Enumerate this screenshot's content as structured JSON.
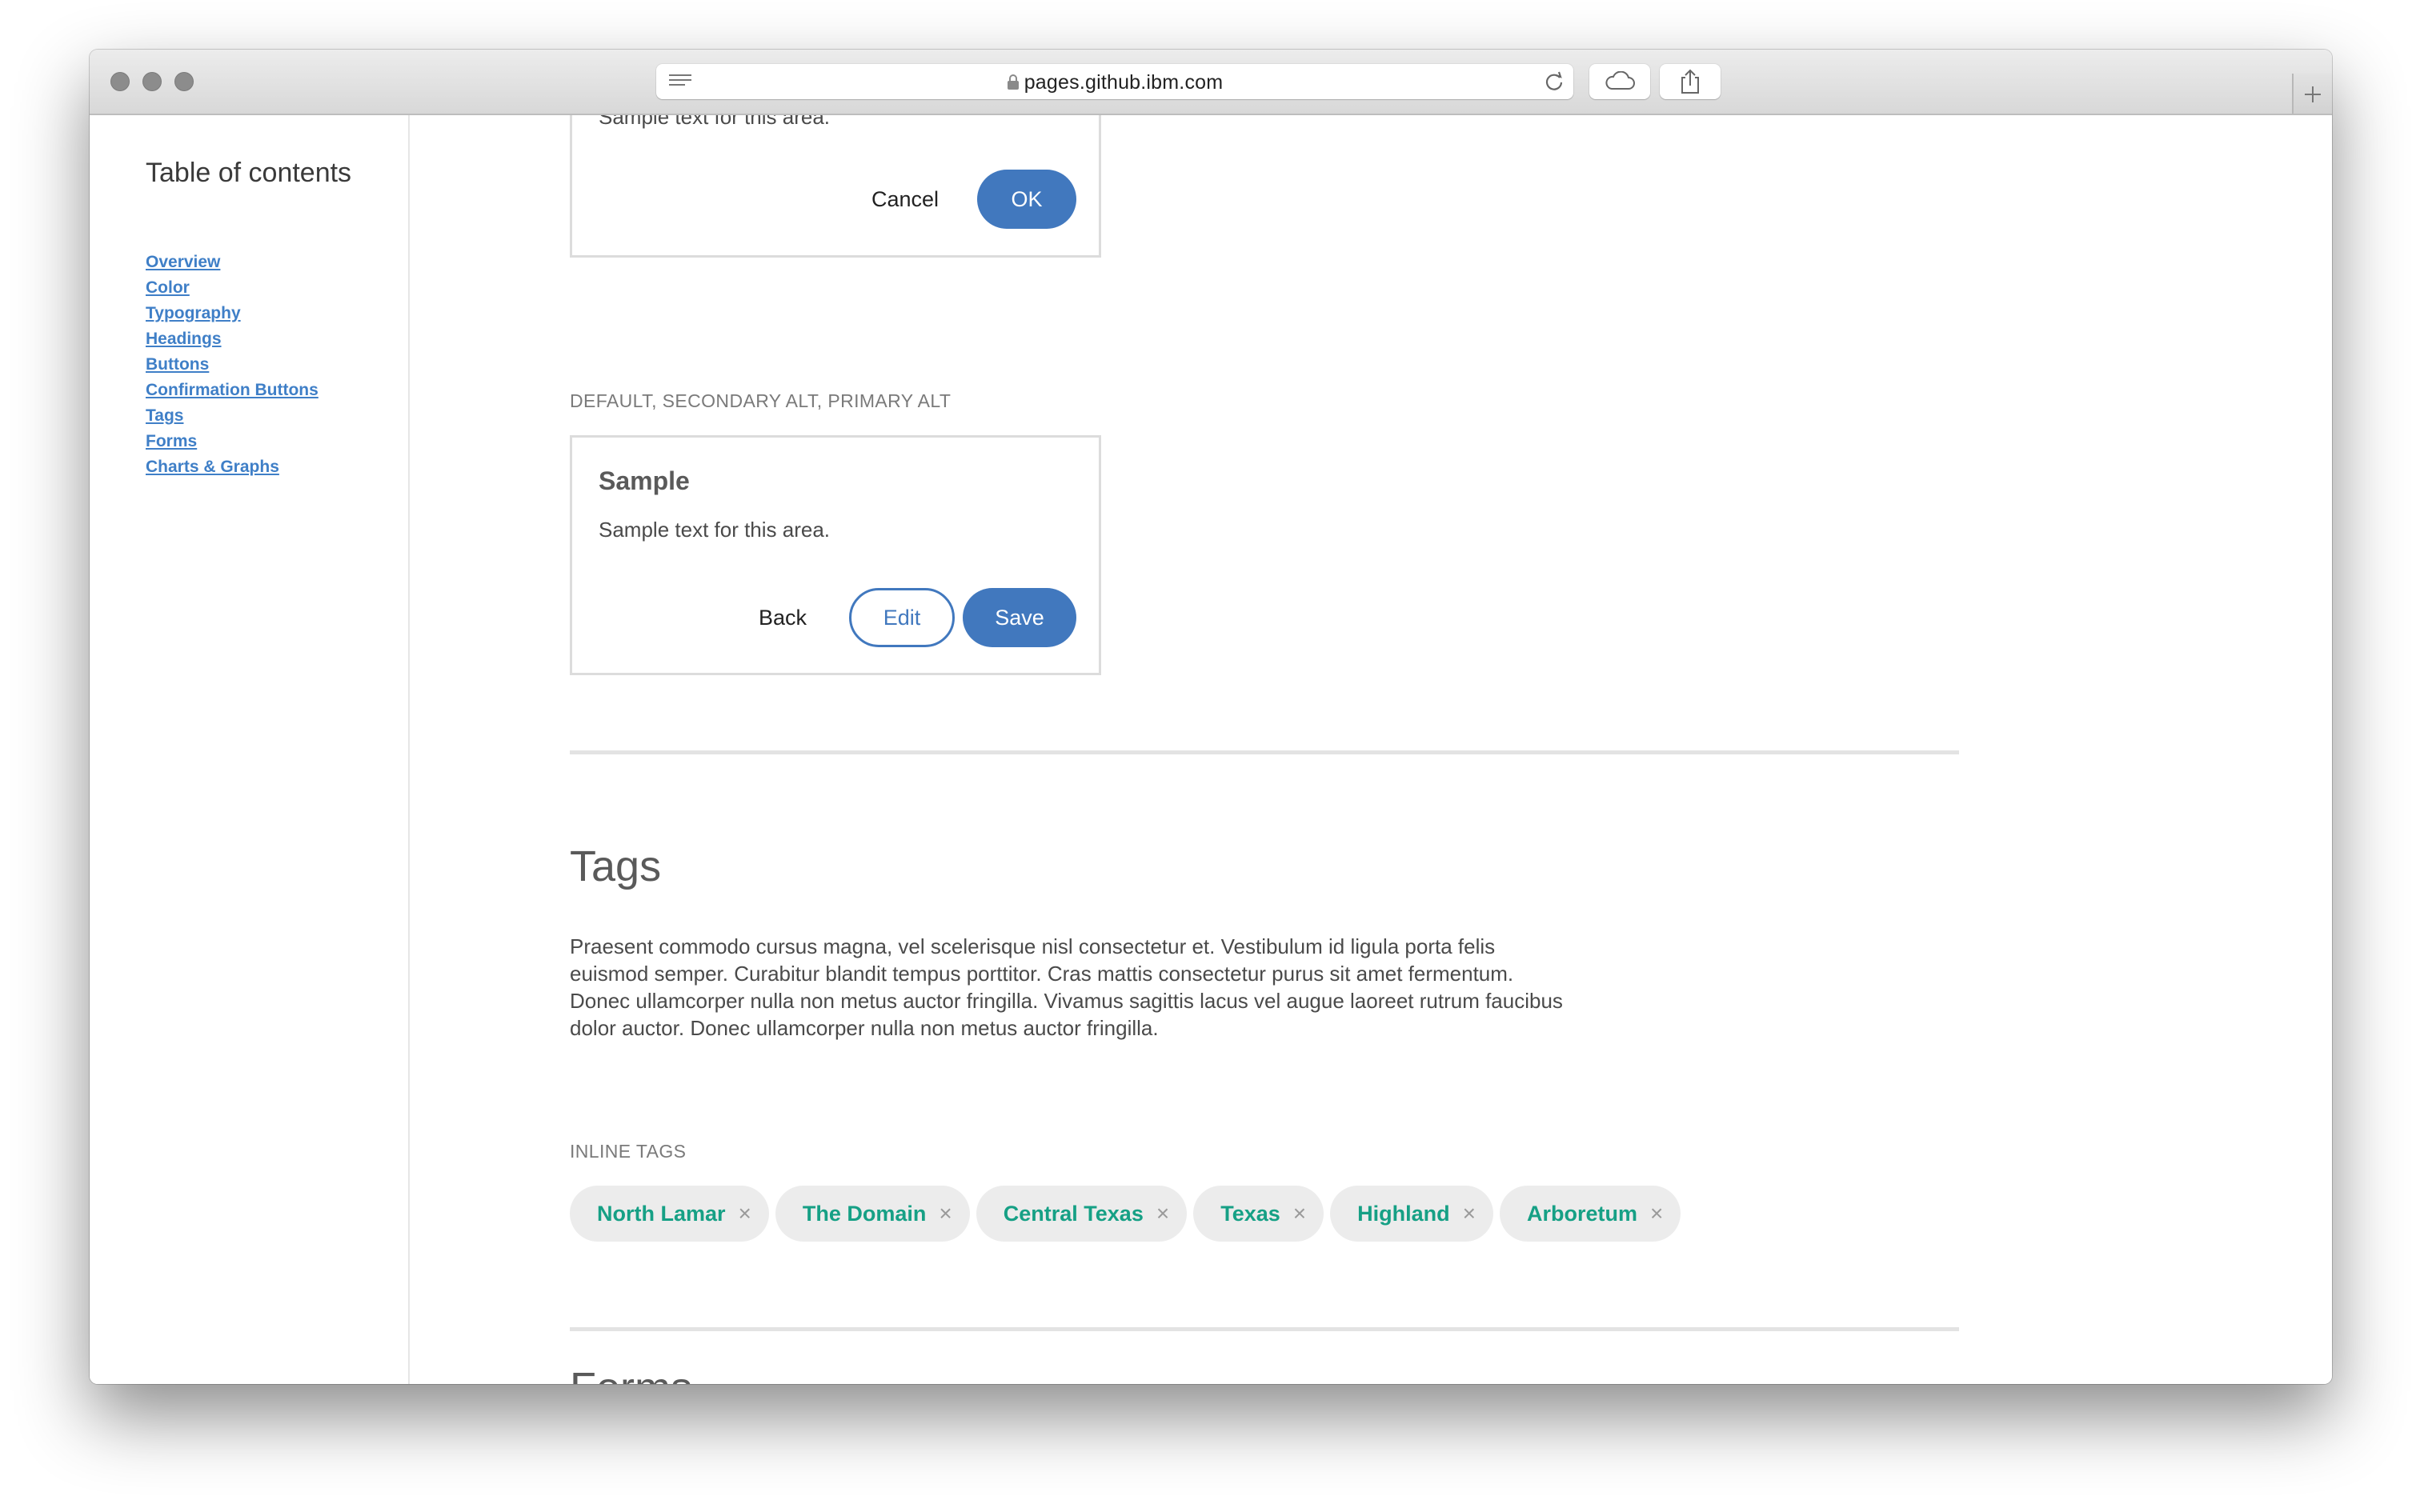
{
  "browser": {
    "url": "pages.github.ibm.com"
  },
  "sidebar": {
    "title": "Table of contents",
    "items": [
      {
        "label": "Overview"
      },
      {
        "label": "Color"
      },
      {
        "label": "Typography"
      },
      {
        "label": "Headings"
      },
      {
        "label": "Buttons"
      },
      {
        "label": "Confirmation Buttons"
      },
      {
        "label": "Tags"
      },
      {
        "label": "Forms"
      },
      {
        "label": "Charts & Graphs"
      }
    ]
  },
  "main": {
    "card1": {
      "text": "Sample text for this area.",
      "cancel_label": "Cancel",
      "ok_label": "OK"
    },
    "section2_label": "DEFAULT, SECONDARY ALT, PRIMARY ALT",
    "card2": {
      "title": "Sample",
      "text": "Sample text for this area.",
      "back_label": "Back",
      "edit_label": "Edit",
      "save_label": "Save"
    },
    "tags_section": {
      "title": "Tags",
      "body": "Praesent commodo cursus magna, vel scelerisque nisl consectetur et. Vestibulum id ligula porta felis euismod semper. Curabitur blandit tempus porttitor. Cras mattis consectetur purus sit amet fermentum. Donec ullamcorper nulla non metus auctor fringilla. Vivamus sagittis lacus vel augue laoreet rutrum faucibus dolor auctor. Donec ullamcorper nulla non metus auctor fringilla.",
      "inline_label": "INLINE TAGS",
      "tags": [
        "North Lamar",
        "The Domain",
        "Central Texas",
        "Texas",
        "Highland",
        "Arboretum"
      ],
      "remove_glyph": "×"
    },
    "next_section_title": "Forms"
  },
  "colors": {
    "primary": "#4178be",
    "link": "#3f7fc7",
    "tag_text": "#16a085",
    "tag_bg": "#ececec"
  }
}
